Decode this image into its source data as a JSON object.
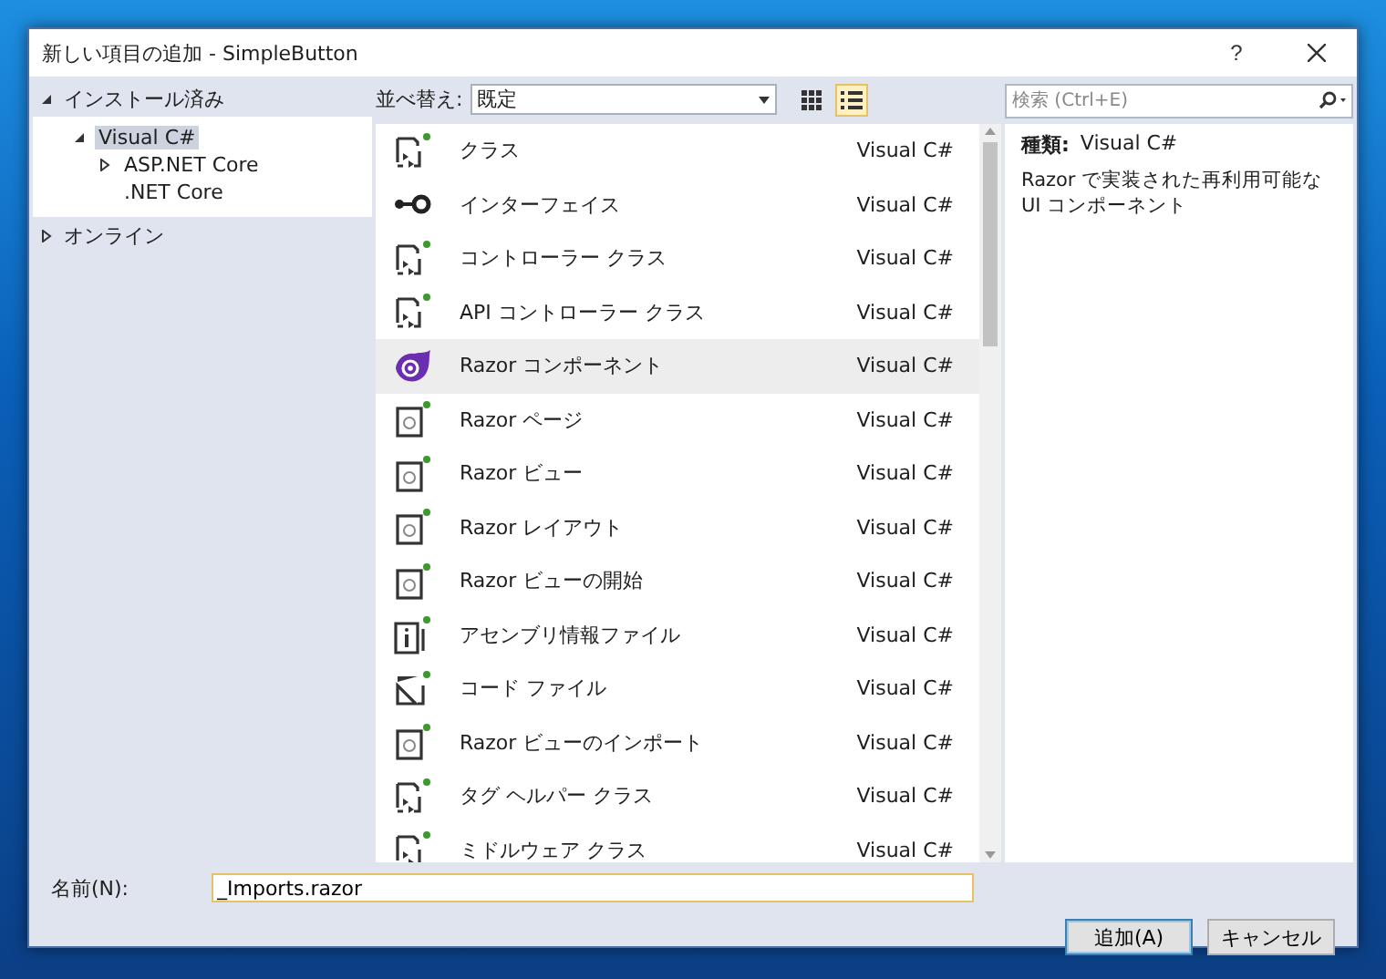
{
  "window": {
    "title": "新しい項目の追加 - SimpleButton",
    "help": "?"
  },
  "sidebar": {
    "sections": [
      {
        "label": "インストール済み",
        "expanded": true,
        "items": [
          {
            "label": "Visual C#",
            "kind": "group",
            "expanded": true,
            "selected": true,
            "children": [
              {
                "label": "ASP.NET Core",
                "kind": "group",
                "expanded": false,
                "selected": false
              },
              {
                "label": ".NET Core",
                "kind": "leaf",
                "selected": false
              }
            ]
          }
        ]
      },
      {
        "label": "オンライン",
        "expanded": false
      }
    ]
  },
  "toolbar": {
    "sort_label": "並べ替え:",
    "sort_value": "既定",
    "view_buttons": [
      {
        "kind": "grid",
        "selected": false
      },
      {
        "kind": "list",
        "selected": true
      }
    ]
  },
  "search": {
    "placeholder": "検索 (Ctrl+E)"
  },
  "templates": [
    {
      "name": "クラス",
      "language": "Visual C#",
      "kind": "class",
      "selected": false
    },
    {
      "name": "インターフェイス",
      "language": "Visual C#",
      "kind": "interface",
      "selected": false
    },
    {
      "name": "コントローラー クラス",
      "language": "Visual C#",
      "kind": "class",
      "selected": false
    },
    {
      "name": "API コントローラー クラス",
      "language": "Visual C#",
      "kind": "class",
      "selected": false
    },
    {
      "name": "Razor コンポーネント",
      "language": "Visual C#",
      "kind": "component",
      "selected": true
    },
    {
      "name": "Razor ページ",
      "language": "Visual C#",
      "kind": "razor",
      "selected": false
    },
    {
      "name": "Razor ビュー",
      "language": "Visual C#",
      "kind": "razor",
      "selected": false
    },
    {
      "name": "Razor レイアウト",
      "language": "Visual C#",
      "kind": "razor",
      "selected": false
    },
    {
      "name": "Razor ビューの開始",
      "language": "Visual C#",
      "kind": "razor",
      "selected": false
    },
    {
      "name": "アセンブリ情報ファイル",
      "language": "Visual C#",
      "kind": "info",
      "selected": false
    },
    {
      "name": "コード ファイル",
      "language": "Visual C#",
      "kind": "code",
      "selected": false
    },
    {
      "name": "Razor ビューのインポート",
      "language": "Visual C#",
      "kind": "razor",
      "selected": false
    },
    {
      "name": "タグ ヘルパー クラス",
      "language": "Visual C#",
      "kind": "class",
      "selected": false
    },
    {
      "name": "ミドルウェア クラス",
      "language": "Visual C#",
      "kind": "class",
      "selected": false
    }
  ],
  "details": {
    "type_label": "種類:",
    "type_value": "Visual C#",
    "description": "Razor で実装された再利用可能な UI コンポーネント"
  },
  "name_field": {
    "label": "名前(N):",
    "value": "_Imports.razor"
  },
  "buttons": [
    {
      "label": "追加(A)",
      "kind": "primary"
    },
    {
      "label": "キャンセル",
      "kind": "normal"
    }
  ]
}
